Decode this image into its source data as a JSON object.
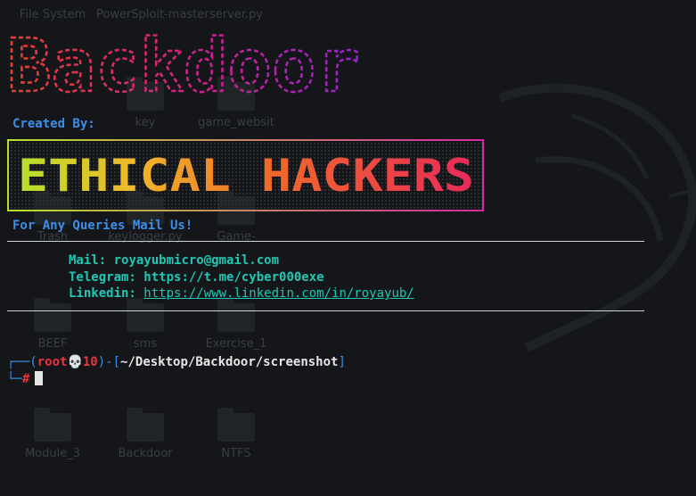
{
  "desktop": {
    "icons": [
      {
        "label": "File System"
      },
      {
        "label": "PowerSploit-master"
      },
      {
        "label": "server.py"
      },
      {
        "label": "key"
      },
      {
        "label": "game_websit"
      },
      {
        "label": "Trash"
      },
      {
        "label": "keylogger.py"
      },
      {
        "label": "Game-"
      },
      {
        "label": "BEEF"
      },
      {
        "label": "sms"
      },
      {
        "label": "Exercise_1"
      },
      {
        "label": "Module_3"
      },
      {
        "label": "Backdoor"
      },
      {
        "label": "NTFS"
      }
    ]
  },
  "banner": {
    "title_logo": "Backdoor",
    "created_by": "Created By:",
    "team_logo": "ETHICAL HACKERS",
    "queries": "For Any Queries Mail Us!"
  },
  "contact": {
    "mail_label": "Mail:",
    "mail_value": "royayubmicro@gmail.com",
    "telegram_label": "Telegram:",
    "telegram_value": "https://t.me/cyber000exe",
    "linkedin_label": "Linkedin:",
    "linkedin_value": "https://www.linkedin.com/in/royayub/"
  },
  "prompt": {
    "user": "root",
    "skull": "💀",
    "host": "10",
    "path": "~/Desktop/Backdoor/screenshot",
    "symbol": "#"
  },
  "colors": {
    "background": "#141619",
    "heading_blue": "#3b8eea",
    "teal": "#1fc7b4",
    "prompt_red": "#e8343d"
  }
}
